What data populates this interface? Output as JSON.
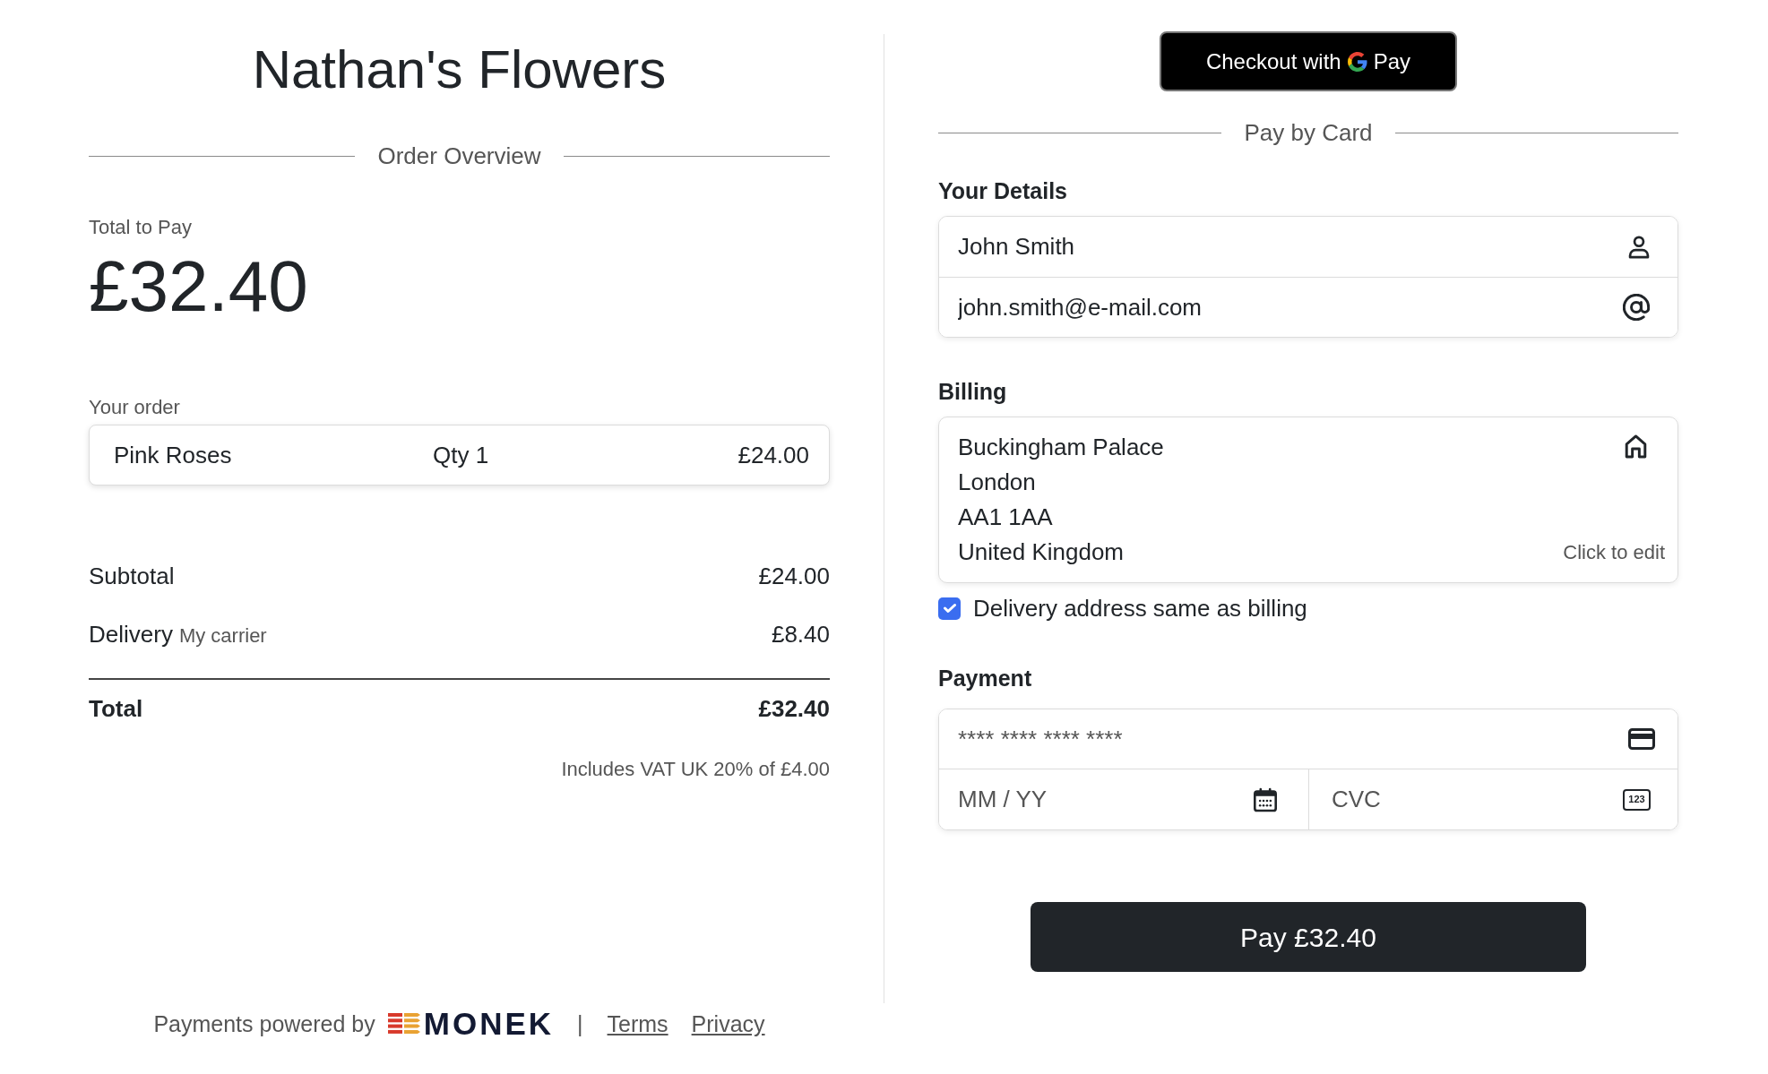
{
  "order_overview": {
    "title": "Nathan's Flowers",
    "heading": "Order Overview",
    "total_label": "Total to Pay",
    "total_amount": "£32.40",
    "order_label": "Your order",
    "items": [
      {
        "name": "Pink Roses",
        "qty": "Qty 1",
        "price": "£24.00"
      }
    ],
    "summary": [
      {
        "kind": "line",
        "label": "Subtotal",
        "amount": "£24.00"
      },
      {
        "kind": "line",
        "label": "Delivery",
        "note": "My carrier",
        "amount": "£8.40"
      },
      {
        "kind": "total",
        "label": "Total",
        "amount": "£32.40"
      }
    ],
    "vat_note": "Includes VAT UK 20% of £4.00"
  },
  "payment_panel": {
    "gpay_button": {
      "label": "Checkout with",
      "brand_text": "Pay"
    },
    "heading": "Pay by Card",
    "details": {
      "title": "Your Details",
      "fields": [
        {
          "kind": "name",
          "value": "John Smith"
        },
        {
          "kind": "email",
          "value": "john.smith@e-mail.com"
        }
      ]
    },
    "billing": {
      "title": "Billing",
      "address_lines": [
        "Buckingham Palace",
        "London",
        "AA1 1AA",
        "United Kingdom"
      ],
      "edit_hint": "Click to edit"
    },
    "delivery_same": {
      "label": "Delivery address same as billing",
      "checked": true
    },
    "payment": {
      "title": "Payment",
      "fields": [
        {
          "kind": "card_number",
          "placeholder": "**** **** **** ****"
        },
        {
          "kind": "expiry",
          "placeholder": "MM / YY"
        },
        {
          "kind": "cvc",
          "placeholder": "CVC",
          "icon_text": "123"
        }
      ]
    },
    "pay_button": "Pay £32.40"
  },
  "footer": {
    "powered_by": "Payments powered by",
    "logo_text": "MONEK",
    "separator": "|",
    "links": [
      "Terms",
      "Privacy"
    ]
  }
}
